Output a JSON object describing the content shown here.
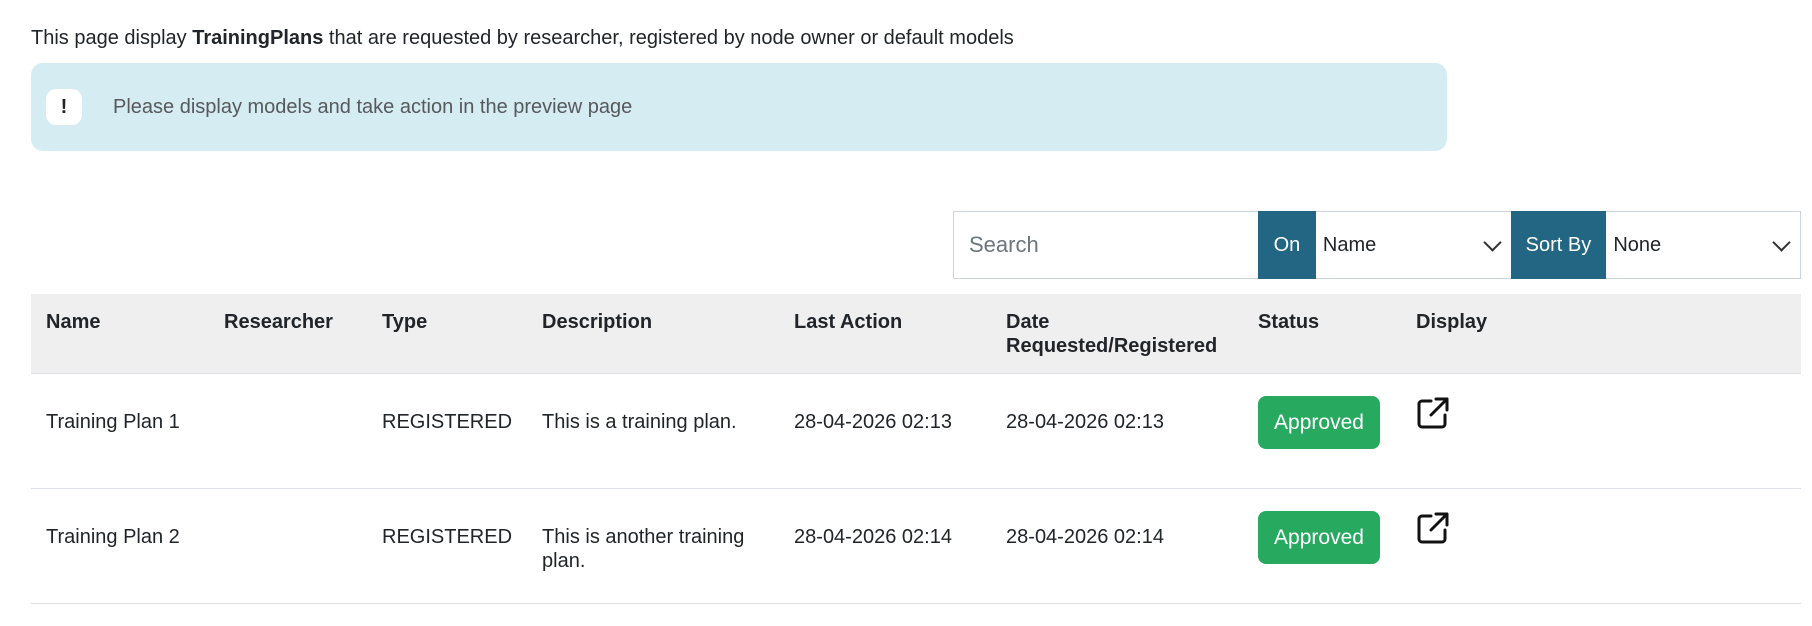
{
  "intro": {
    "prefix": "This page display ",
    "bold": "TrainingPlans",
    "suffix": " that are requested by researcher, registered by node owner or default models"
  },
  "alert": {
    "icon": "!",
    "icon_name": "exclamation-icon",
    "text": "Please display models and take action in the preview page"
  },
  "toolbar": {
    "search_placeholder": "Search",
    "on_label": "On",
    "on_select_value": "Name",
    "sort_label": "Sort By",
    "sort_select_value": "None",
    "accent_color": "#236683"
  },
  "table": {
    "headers": {
      "name": "Name",
      "researcher": "Researcher",
      "type": "Type",
      "description": "Description",
      "last_action": "Last Action",
      "date_line1": "Date",
      "date_line2": "Requested/Registered",
      "status": "Status",
      "display": "Display"
    },
    "rows": [
      {
        "name": "Training Plan 1",
        "researcher": "",
        "type": "REGISTERED",
        "description": "This is a training plan.",
        "last_action": "28-04-2026 02:13",
        "date": "28-04-2026 02:13",
        "status": "Approved",
        "display_icon": "external-link-icon"
      },
      {
        "name": "Training Plan 2",
        "researcher": "",
        "type": "REGISTERED",
        "description": "This is another training plan.",
        "last_action": "28-04-2026 02:14",
        "date": "28-04-2026 02:14",
        "status": "Approved",
        "display_icon": "external-link-icon"
      }
    ],
    "status_color": "#28a960",
    "header_bg": "#efefef"
  }
}
